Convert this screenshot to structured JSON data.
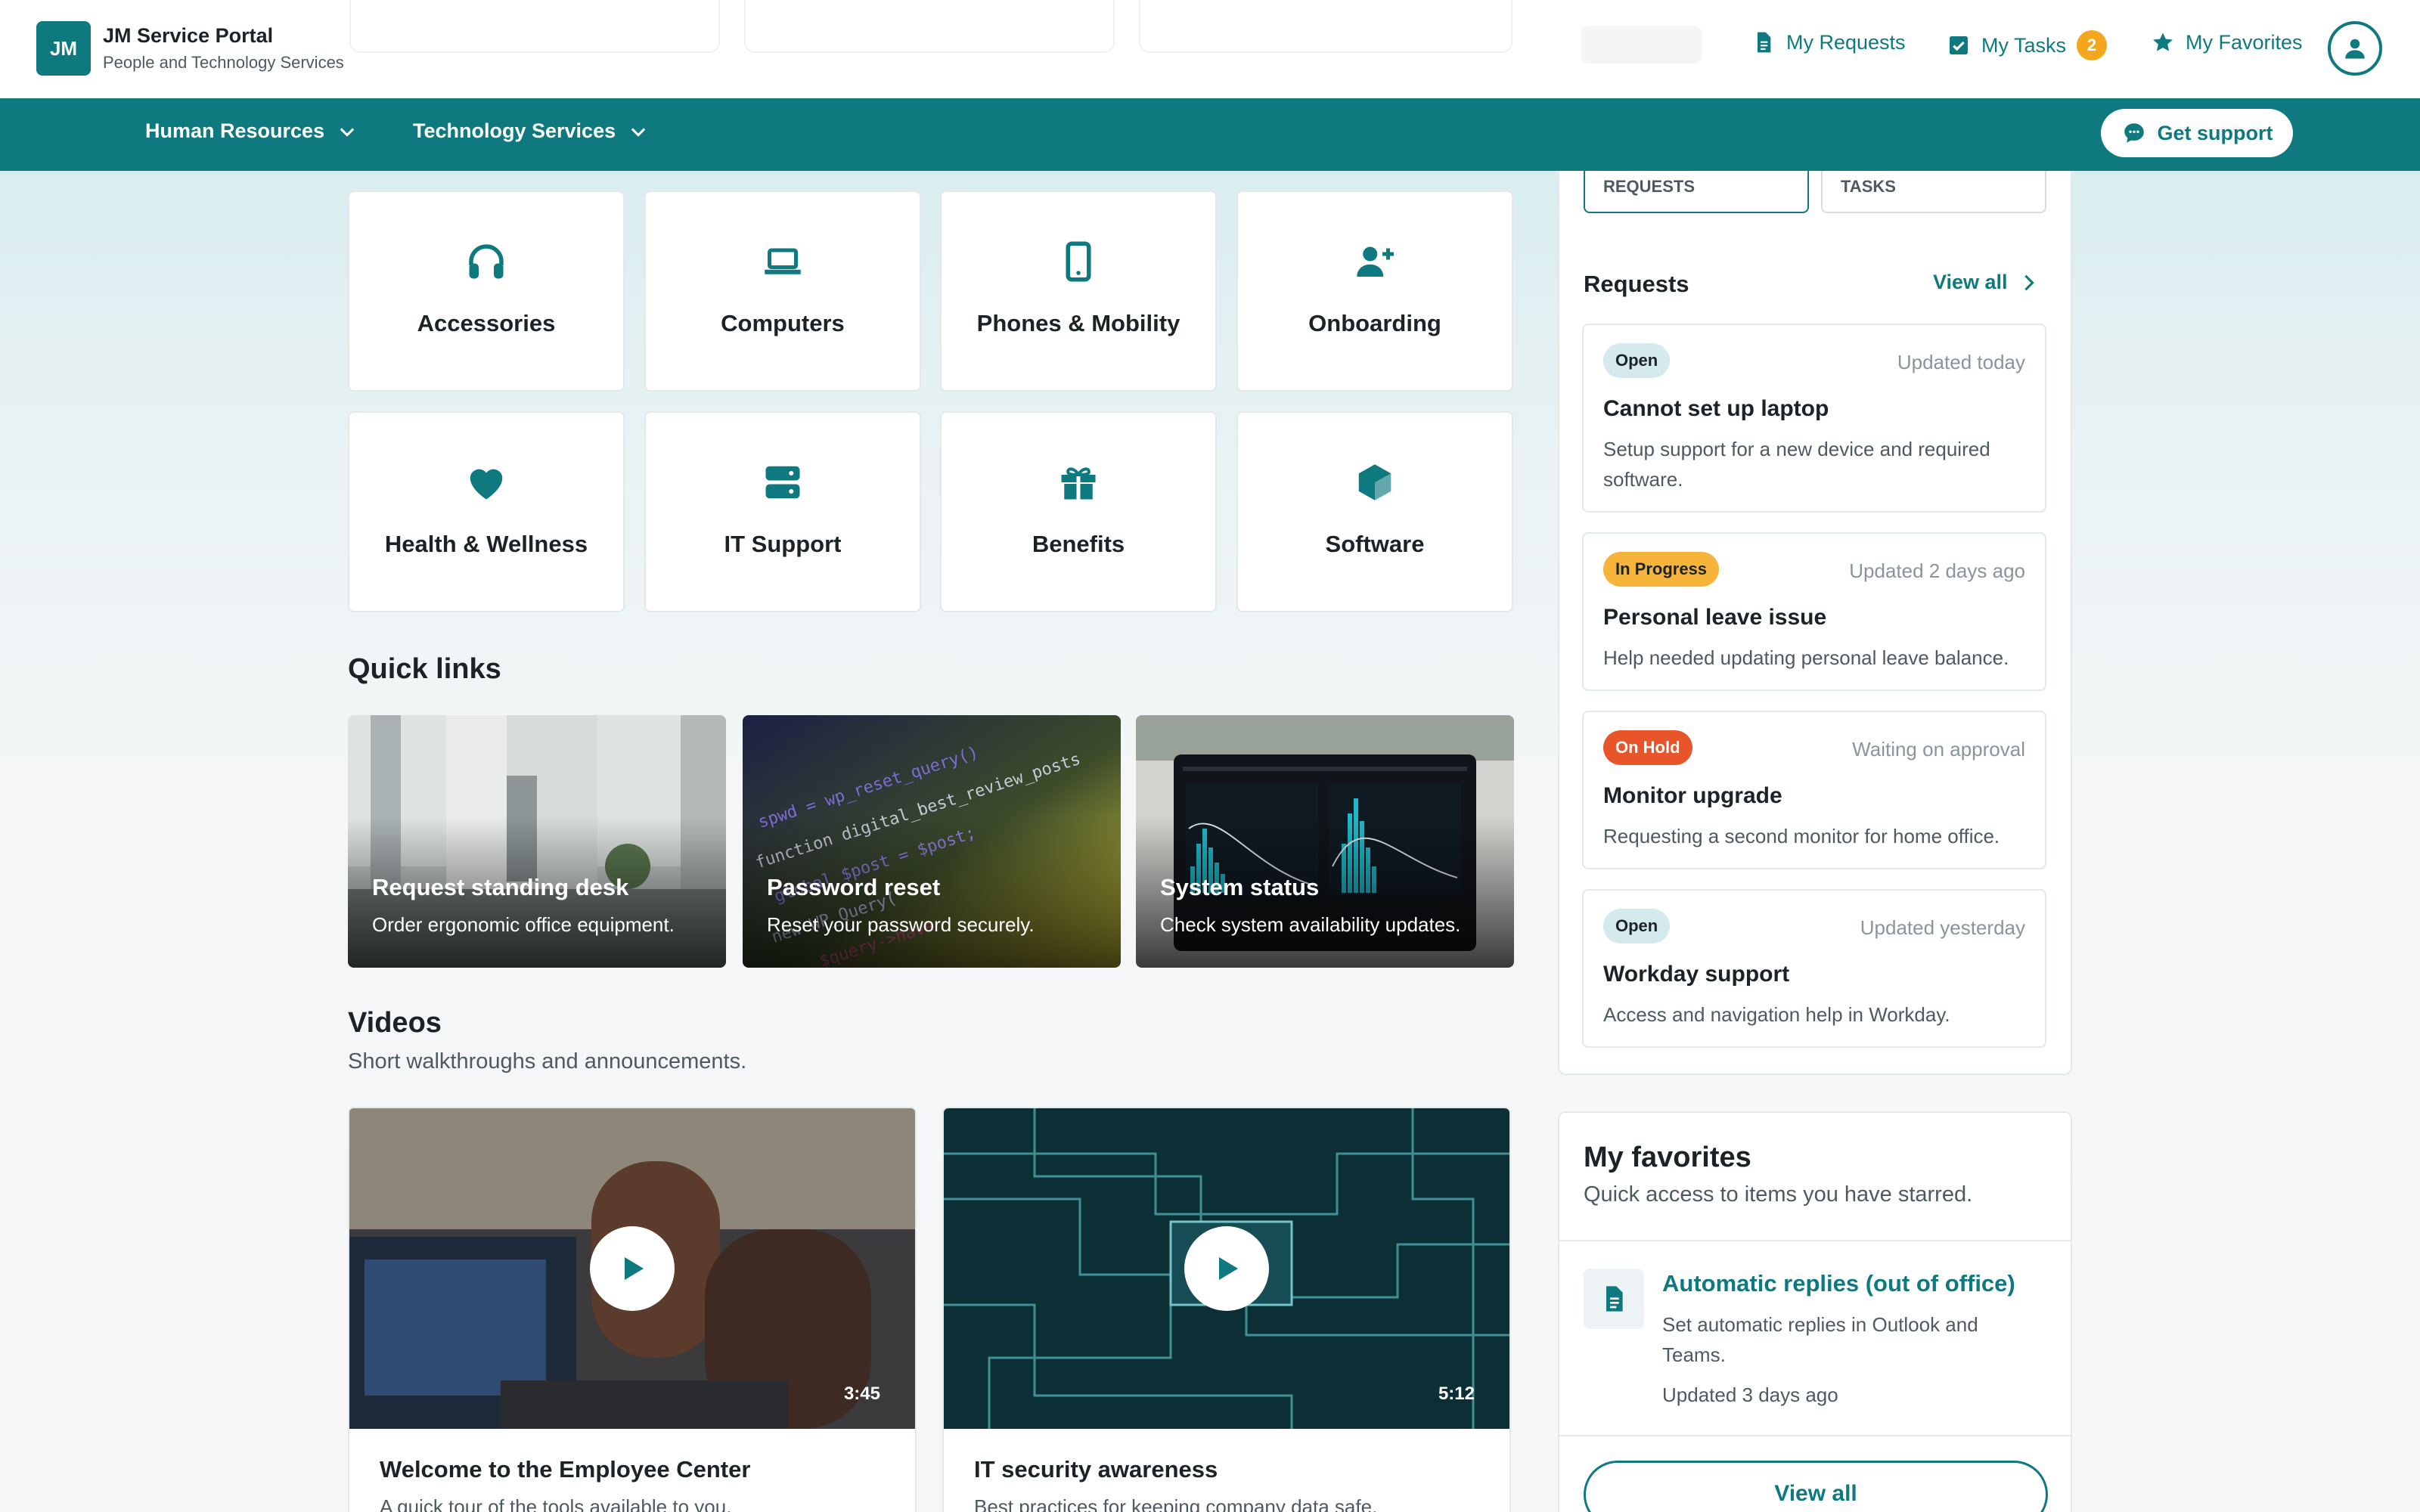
{
  "brand": {
    "logo_initials": "JM",
    "title": "JM Service Portal",
    "subtitle": "People and Technology Services"
  },
  "topnav": {
    "my_requests": "My Requests",
    "my_tasks": "My Tasks",
    "my_tasks_count": "2",
    "my_favorites": "My Favorites"
  },
  "mainnav": {
    "items": [
      {
        "label": "Human Resources"
      },
      {
        "label": "Technology Services"
      }
    ],
    "support_button": "Get support"
  },
  "categories": [
    {
      "label": "Accessories",
      "icon": "headphones-icon"
    },
    {
      "label": "Computers",
      "icon": "laptop-icon"
    },
    {
      "label": "Phones & Mobility",
      "icon": "phone-icon"
    },
    {
      "label": "Onboarding",
      "icon": "user-plus-icon"
    },
    {
      "label": "Health & Wellness",
      "icon": "heart-icon"
    },
    {
      "label": "IT Support",
      "icon": "server-icon"
    },
    {
      "label": "Benefits",
      "icon": "gift-icon"
    },
    {
      "label": "Software",
      "icon": "cube-icon"
    }
  ],
  "quick_links": {
    "title": "Quick links",
    "items": [
      {
        "title": "Request standing desk",
        "description": "Order ergonomic office equipment."
      },
      {
        "title": "Password reset",
        "description": "Reset your password securely."
      },
      {
        "title": "System status",
        "description": "Check system availability updates."
      }
    ]
  },
  "videos": {
    "title": "Videos",
    "subtitle": "Short walkthroughs and announcements.",
    "items": [
      {
        "title": "Welcome to the Employee Center",
        "description": "A quick tour of the tools available to you.",
        "duration": "3:45"
      },
      {
        "title": "IT security awareness",
        "description": "Best practices for keeping company data safe.",
        "duration": "5:12"
      }
    ]
  },
  "panel": {
    "tabs": [
      "REQUESTS",
      "TASKS"
    ],
    "requests_heading": "Requests",
    "view_all": "View all",
    "requests": [
      {
        "status": "Open",
        "updated": "Updated today",
        "title": "Cannot set up laptop",
        "description": "Setup support for a new device and required software."
      },
      {
        "status": "In Progress",
        "updated": "Updated 2 days ago",
        "title": "Personal leave issue",
        "description": "Help needed updating personal leave balance."
      },
      {
        "status": "On Hold",
        "updated": "Waiting on approval",
        "title": "Monitor upgrade",
        "description": "Requesting a second monitor for home office."
      },
      {
        "status": "Open",
        "updated": "Updated yesterday",
        "title": "Workday support",
        "description": "Access and navigation help in Workday."
      }
    ]
  },
  "favorites": {
    "title": "My favorites",
    "subtitle": "Quick access to items you have starred.",
    "item": {
      "name": "Automatic replies (out of office)",
      "description": "Set automatic replies in Outlook and Teams.",
      "updated": "Updated 3 days ago"
    },
    "view_all": "View all"
  },
  "colors": {
    "brand": "#0e7a80",
    "badge": "#f4a71d",
    "status_open": "#d4eaec",
    "status_in_progress": "#f6b43a",
    "status_on_hold": "#e8552b"
  }
}
